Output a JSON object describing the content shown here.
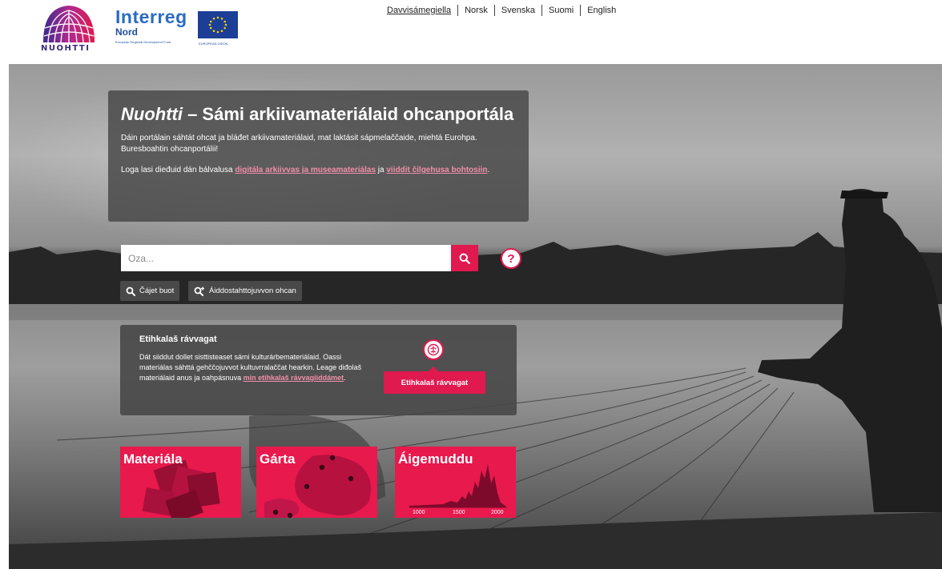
{
  "header": {
    "logo_nuohtti": "NUOHTTI",
    "interreg": {
      "title": "Interreg",
      "subtitle": "Nord",
      "fund": "European Regional Development Fund",
      "eu": "EUROPEAN UNION"
    },
    "languages": [
      {
        "label": "Davvisámegiella",
        "active": true
      },
      {
        "label": "Norsk",
        "active": false
      },
      {
        "label": "Svenska",
        "active": false
      },
      {
        "label": "Suomi",
        "active": false
      },
      {
        "label": "English",
        "active": false
      }
    ]
  },
  "intro": {
    "title_italic": "Nuohtti",
    "title_rest": " – Sámi arkiivamateriálaid ohcanportála",
    "paragraph1": "Dáin portálain sáhtát ohcat ja bláđet arkiivamateriálaid, mat laktásit sápmelaččaide, miehtá Eurohpa. Buresboahtin ohcanportálii!",
    "paragraph2_prefix": "Loga lasi dieđuid dán bálvalusa ",
    "link1": "digitála arkiivvas ja museamateriálas",
    "paragraph2_mid": " ja ",
    "link2": "viiddit čilgehusa bohtosiin",
    "paragraph2_suffix": "."
  },
  "search": {
    "placeholder": "Oza...",
    "help_symbol": "?",
    "show_all_label": "Čájet buot",
    "advanced_label": "Áiddostahttojuvvon ohcan"
  },
  "ethics": {
    "title": "Etihkalaš rávvagat",
    "text_prefix": "Dát siiddut dollet sisttisteaset sámi kulturárbemateriálaid. Oassi materiálas sáhttá gehččojuvvot kultuvrralaččat hearkin. Leage diđolaš materiálaid anus ja oahpásnuva ",
    "link": "min etihkalaš rávvagiiddámet",
    "text_suffix": ".",
    "button_label": "Etihkalaš rávvagat"
  },
  "tiles": [
    {
      "label": "Materiála"
    },
    {
      "label": "Gárta"
    },
    {
      "label": "Áigemuddu",
      "axis_ticks": [
        "1000",
        "1500",
        "2000"
      ]
    }
  ],
  "colors": {
    "accent": "#e0194f",
    "tile": "#e8194d",
    "link": "#f08fa8",
    "overlay": "#464646"
  }
}
